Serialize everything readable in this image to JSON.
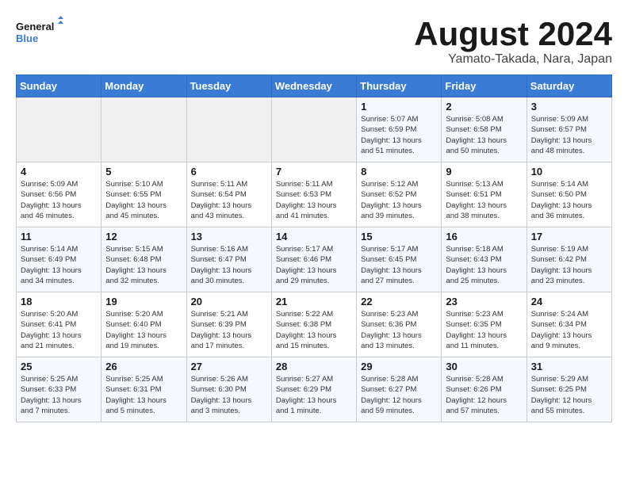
{
  "logo": {
    "line1": "General",
    "line2": "Blue"
  },
  "title": "August 2024",
  "subtitle": "Yamato-Takada, Nara, Japan",
  "weekdays": [
    "Sunday",
    "Monday",
    "Tuesday",
    "Wednesday",
    "Thursday",
    "Friday",
    "Saturday"
  ],
  "weeks": [
    [
      {
        "day": "",
        "info": ""
      },
      {
        "day": "",
        "info": ""
      },
      {
        "day": "",
        "info": ""
      },
      {
        "day": "",
        "info": ""
      },
      {
        "day": "1",
        "info": "Sunrise: 5:07 AM\nSunset: 6:59 PM\nDaylight: 13 hours\nand 51 minutes."
      },
      {
        "day": "2",
        "info": "Sunrise: 5:08 AM\nSunset: 6:58 PM\nDaylight: 13 hours\nand 50 minutes."
      },
      {
        "day": "3",
        "info": "Sunrise: 5:09 AM\nSunset: 6:57 PM\nDaylight: 13 hours\nand 48 minutes."
      }
    ],
    [
      {
        "day": "4",
        "info": "Sunrise: 5:09 AM\nSunset: 6:56 PM\nDaylight: 13 hours\nand 46 minutes."
      },
      {
        "day": "5",
        "info": "Sunrise: 5:10 AM\nSunset: 6:55 PM\nDaylight: 13 hours\nand 45 minutes."
      },
      {
        "day": "6",
        "info": "Sunrise: 5:11 AM\nSunset: 6:54 PM\nDaylight: 13 hours\nand 43 minutes."
      },
      {
        "day": "7",
        "info": "Sunrise: 5:11 AM\nSunset: 6:53 PM\nDaylight: 13 hours\nand 41 minutes."
      },
      {
        "day": "8",
        "info": "Sunrise: 5:12 AM\nSunset: 6:52 PM\nDaylight: 13 hours\nand 39 minutes."
      },
      {
        "day": "9",
        "info": "Sunrise: 5:13 AM\nSunset: 6:51 PM\nDaylight: 13 hours\nand 38 minutes."
      },
      {
        "day": "10",
        "info": "Sunrise: 5:14 AM\nSunset: 6:50 PM\nDaylight: 13 hours\nand 36 minutes."
      }
    ],
    [
      {
        "day": "11",
        "info": "Sunrise: 5:14 AM\nSunset: 6:49 PM\nDaylight: 13 hours\nand 34 minutes."
      },
      {
        "day": "12",
        "info": "Sunrise: 5:15 AM\nSunset: 6:48 PM\nDaylight: 13 hours\nand 32 minutes."
      },
      {
        "day": "13",
        "info": "Sunrise: 5:16 AM\nSunset: 6:47 PM\nDaylight: 13 hours\nand 30 minutes."
      },
      {
        "day": "14",
        "info": "Sunrise: 5:17 AM\nSunset: 6:46 PM\nDaylight: 13 hours\nand 29 minutes."
      },
      {
        "day": "15",
        "info": "Sunrise: 5:17 AM\nSunset: 6:45 PM\nDaylight: 13 hours\nand 27 minutes."
      },
      {
        "day": "16",
        "info": "Sunrise: 5:18 AM\nSunset: 6:43 PM\nDaylight: 13 hours\nand 25 minutes."
      },
      {
        "day": "17",
        "info": "Sunrise: 5:19 AM\nSunset: 6:42 PM\nDaylight: 13 hours\nand 23 minutes."
      }
    ],
    [
      {
        "day": "18",
        "info": "Sunrise: 5:20 AM\nSunset: 6:41 PM\nDaylight: 13 hours\nand 21 minutes."
      },
      {
        "day": "19",
        "info": "Sunrise: 5:20 AM\nSunset: 6:40 PM\nDaylight: 13 hours\nand 19 minutes."
      },
      {
        "day": "20",
        "info": "Sunrise: 5:21 AM\nSunset: 6:39 PM\nDaylight: 13 hours\nand 17 minutes."
      },
      {
        "day": "21",
        "info": "Sunrise: 5:22 AM\nSunset: 6:38 PM\nDaylight: 13 hours\nand 15 minutes."
      },
      {
        "day": "22",
        "info": "Sunrise: 5:23 AM\nSunset: 6:36 PM\nDaylight: 13 hours\nand 13 minutes."
      },
      {
        "day": "23",
        "info": "Sunrise: 5:23 AM\nSunset: 6:35 PM\nDaylight: 13 hours\nand 11 minutes."
      },
      {
        "day": "24",
        "info": "Sunrise: 5:24 AM\nSunset: 6:34 PM\nDaylight: 13 hours\nand 9 minutes."
      }
    ],
    [
      {
        "day": "25",
        "info": "Sunrise: 5:25 AM\nSunset: 6:33 PM\nDaylight: 13 hours\nand 7 minutes."
      },
      {
        "day": "26",
        "info": "Sunrise: 5:25 AM\nSunset: 6:31 PM\nDaylight: 13 hours\nand 5 minutes."
      },
      {
        "day": "27",
        "info": "Sunrise: 5:26 AM\nSunset: 6:30 PM\nDaylight: 13 hours\nand 3 minutes."
      },
      {
        "day": "28",
        "info": "Sunrise: 5:27 AM\nSunset: 6:29 PM\nDaylight: 13 hours\nand 1 minute."
      },
      {
        "day": "29",
        "info": "Sunrise: 5:28 AM\nSunset: 6:27 PM\nDaylight: 12 hours\nand 59 minutes."
      },
      {
        "day": "30",
        "info": "Sunrise: 5:28 AM\nSunset: 6:26 PM\nDaylight: 12 hours\nand 57 minutes."
      },
      {
        "day": "31",
        "info": "Sunrise: 5:29 AM\nSunset: 6:25 PM\nDaylight: 12 hours\nand 55 minutes."
      }
    ]
  ]
}
